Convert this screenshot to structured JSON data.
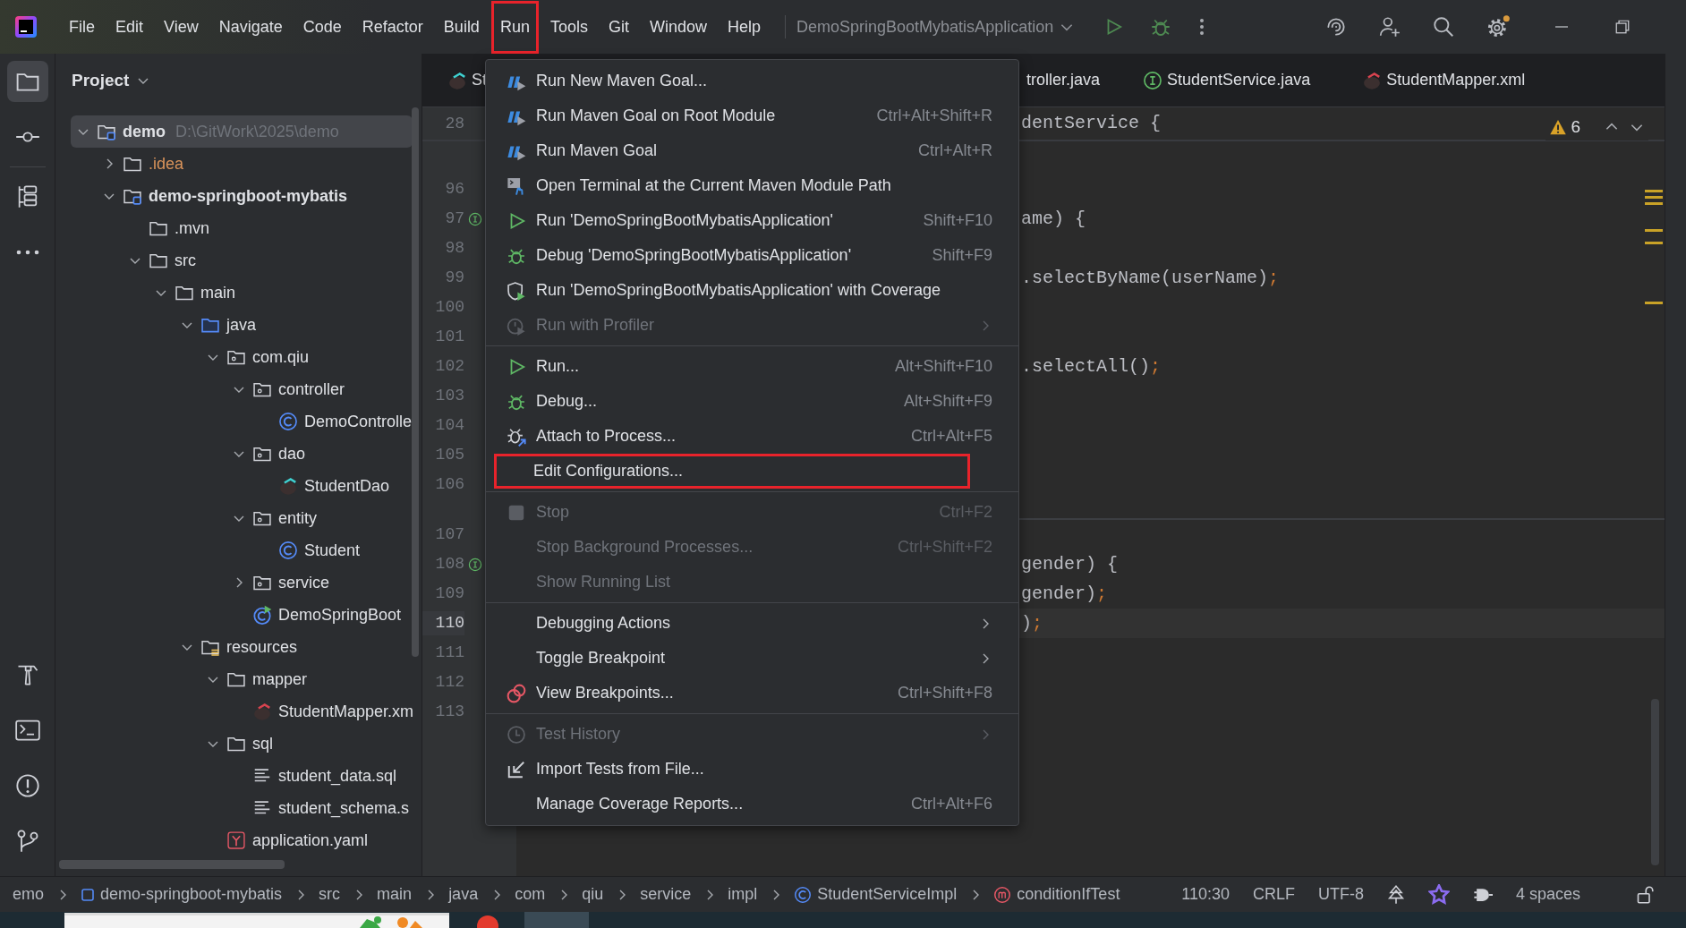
{
  "menu_bar": {
    "items": [
      {
        "label": "File",
        "highlighted": false
      },
      {
        "label": "Edit",
        "highlighted": false
      },
      {
        "label": "View",
        "highlighted": false
      },
      {
        "label": "Navigate",
        "highlighted": false
      },
      {
        "label": "Code",
        "highlighted": false
      },
      {
        "label": "Refactor",
        "highlighted": false
      },
      {
        "label": "Build",
        "highlighted": false
      },
      {
        "label": "Run",
        "highlighted": true
      },
      {
        "label": "Tools",
        "highlighted": false
      },
      {
        "label": "Git",
        "highlighted": false
      },
      {
        "label": "Window",
        "highlighted": false
      },
      {
        "label": "Help",
        "highlighted": false
      }
    ]
  },
  "run_config": {
    "label": "DemoSpringBootMybatisApplication"
  },
  "project": {
    "title": "Project",
    "tree": [
      {
        "label": "demo",
        "kind": "module",
        "path": "D:\\GitWork\\2025\\demo",
        "expanded": true,
        "selected": true,
        "children": [
          {
            "label": ".idea",
            "kind": "excluded-folder",
            "expanded": false,
            "selected": false
          },
          {
            "label": "demo-springboot-mybatis",
            "kind": "module",
            "expanded": true,
            "selected": false,
            "children": [
              {
                "label": ".mvn",
                "kind": "folder",
                "selected": false
              },
              {
                "label": "src",
                "kind": "folder",
                "expanded": true,
                "selected": false,
                "children": [
                  {
                    "label": "main",
                    "kind": "folder",
                    "expanded": true,
                    "selected": false,
                    "children": [
                      {
                        "label": "java",
                        "kind": "source-folder",
                        "expanded": true,
                        "selected": false,
                        "children": [
                          {
                            "label": "com.qiu",
                            "kind": "package",
                            "expanded": true,
                            "selected": false,
                            "children": [
                              {
                                "label": "controller",
                                "kind": "package",
                                "expanded": true,
                                "selected": false,
                                "children": [
                                  {
                                    "label": "DemoControlle",
                                    "kind": "class",
                                    "selected": false
                                  }
                                ]
                              },
                              {
                                "label": "dao",
                                "kind": "package",
                                "expanded": true,
                                "selected": false,
                                "children": [
                                  {
                                    "label": "StudentDao",
                                    "kind": "mapper",
                                    "selected": false
                                  }
                                ]
                              },
                              {
                                "label": "entity",
                                "kind": "package",
                                "expanded": true,
                                "selected": false,
                                "children": [
                                  {
                                    "label": "Student",
                                    "kind": "class",
                                    "selected": false
                                  }
                                ]
                              },
                              {
                                "label": "service",
                                "kind": "package",
                                "expanded": false,
                                "selected": false
                              },
                              {
                                "label": "DemoSpringBoot",
                                "kind": "app-class",
                                "selected": false
                              }
                            ]
                          }
                        ]
                      },
                      {
                        "label": "resources",
                        "kind": "resources-folder",
                        "expanded": true,
                        "selected": false,
                        "children": [
                          {
                            "label": "mapper",
                            "kind": "folder",
                            "expanded": true,
                            "selected": false,
                            "children": [
                              {
                                "label": "StudentMapper.xm",
                                "kind": "mapper-xml",
                                "selected": false
                              }
                            ]
                          },
                          {
                            "label": "sql",
                            "kind": "folder",
                            "expanded": true,
                            "selected": false,
                            "children": [
                              {
                                "label": "student_data.sql",
                                "kind": "text-file",
                                "selected": false
                              },
                              {
                                "label": "student_schema.s",
                                "kind": "text-file",
                                "selected": false
                              }
                            ]
                          },
                          {
                            "label": "application.yaml",
                            "kind": "yaml",
                            "selected": false
                          }
                        ]
                      }
                    ]
                  }
                ]
              }
            ]
          }
        ]
      }
    ]
  },
  "editor": {
    "tabs": [
      {
        "label": "St",
        "kind": "mapper"
      },
      {
        "label": "troller.java",
        "kind": "plain"
      },
      {
        "label": "StudentService.java",
        "kind": "interface"
      },
      {
        "label": "StudentMapper.xml",
        "kind": "mapper-xml"
      }
    ],
    "sticky": {
      "number": "28",
      "code": "dentService {"
    },
    "warnings": "6",
    "lines": [
      {
        "number": "96",
        "kind": "plain",
        "current": false
      },
      {
        "number": "97",
        "kind": "implements",
        "current": false,
        "code": "ame) {"
      },
      {
        "number": "98",
        "kind": "plain",
        "current": false
      },
      {
        "number": "99",
        "kind": "plain",
        "current": false,
        "code": ".selectByName(userName)",
        "punctuation": ";"
      },
      {
        "number": "100",
        "kind": "plain",
        "current": false
      },
      {
        "number": "101",
        "kind": "plain",
        "current": false
      },
      {
        "number": "102",
        "kind": "plain",
        "current": false,
        "code": ".selectAll()",
        "punctuation": ";"
      },
      {
        "number": "103",
        "kind": "plain",
        "current": false
      },
      {
        "number": "104",
        "kind": "plain",
        "current": false
      },
      {
        "number": "105",
        "kind": "plain",
        "current": false
      },
      {
        "number": "106",
        "kind": "plain",
        "current": false
      },
      {
        "number": "107",
        "kind": "plain",
        "current": false
      },
      {
        "number": "108",
        "kind": "implements",
        "current": false,
        "code": "gender) {"
      },
      {
        "number": "109",
        "kind": "plain",
        "current": false,
        "code": "gender)",
        "punctuation": ";"
      },
      {
        "number": "110",
        "kind": "plain",
        "current": true,
        "code": ")",
        "punctuation": ";"
      },
      {
        "number": "111",
        "kind": "plain",
        "current": false
      },
      {
        "number": "112",
        "kind": "plain",
        "current": false
      },
      {
        "number": "113",
        "kind": "plain",
        "current": false
      }
    ]
  },
  "run_menu": {
    "items": [
      {
        "kind": "item",
        "label": "Run New Maven Goal...",
        "disabled": false,
        "submenu": false,
        "highlighted": false
      },
      {
        "kind": "item",
        "label": "Run Maven Goal on Root Module",
        "shortcut": "Ctrl+Alt+Shift+R",
        "disabled": false,
        "submenu": false,
        "highlighted": false
      },
      {
        "kind": "item",
        "label": "Run Maven Goal",
        "shortcut": "Ctrl+Alt+R",
        "disabled": false,
        "submenu": false,
        "highlighted": false
      },
      {
        "kind": "item",
        "label": "Open Terminal at the Current Maven Module Path",
        "disabled": false,
        "submenu": false,
        "highlighted": false
      },
      {
        "kind": "item",
        "label": "Run 'DemoSpringBootMybatisApplication'",
        "shortcut": "Shift+F10",
        "disabled": false,
        "submenu": false,
        "highlighted": false
      },
      {
        "kind": "item",
        "label": "Debug 'DemoSpringBootMybatisApplication'",
        "shortcut": "Shift+F9",
        "disabled": false,
        "submenu": false,
        "highlighted": false
      },
      {
        "kind": "item",
        "label": "Run 'DemoSpringBootMybatisApplication' with Coverage",
        "disabled": false,
        "submenu": false,
        "highlighted": false
      },
      {
        "kind": "item",
        "label": "Run with Profiler",
        "disabled": true,
        "submenu": true,
        "highlighted": false
      },
      {
        "kind": "separator"
      },
      {
        "kind": "item",
        "label": "Run...",
        "shortcut": "Alt+Shift+F10",
        "disabled": false,
        "submenu": false,
        "highlighted": false
      },
      {
        "kind": "item",
        "label": "Debug...",
        "shortcut": "Alt+Shift+F9",
        "disabled": false,
        "submenu": false,
        "highlighted": false
      },
      {
        "kind": "item",
        "label": "Attach to Process...",
        "shortcut": "Ctrl+Alt+F5",
        "disabled": false,
        "submenu": false,
        "highlighted": false
      },
      {
        "kind": "item",
        "label": "Edit Configurations...",
        "disabled": false,
        "submenu": false,
        "highlighted": true
      },
      {
        "kind": "separator"
      },
      {
        "kind": "item",
        "label": "Stop",
        "shortcut": "Ctrl+F2",
        "disabled": true,
        "submenu": false,
        "highlighted": false
      },
      {
        "kind": "item",
        "label": "Stop Background Processes...",
        "shortcut": "Ctrl+Shift+F2",
        "disabled": true,
        "submenu": false,
        "highlighted": false
      },
      {
        "kind": "item",
        "label": "Show Running List",
        "disabled": true,
        "submenu": false,
        "highlighted": false
      },
      {
        "kind": "separator"
      },
      {
        "kind": "item",
        "label": "Debugging Actions",
        "disabled": false,
        "submenu": true,
        "highlighted": false
      },
      {
        "kind": "item",
        "label": "Toggle Breakpoint",
        "disabled": false,
        "submenu": true,
        "highlighted": false
      },
      {
        "kind": "item",
        "label": "View Breakpoints...",
        "shortcut": "Ctrl+Shift+F8",
        "disabled": false,
        "submenu": false,
        "highlighted": false
      },
      {
        "kind": "separator"
      },
      {
        "kind": "item",
        "label": "Test History",
        "disabled": true,
        "submenu": true,
        "highlighted": false
      },
      {
        "kind": "item",
        "label": "Import Tests from File...",
        "disabled": false,
        "submenu": false,
        "highlighted": false
      },
      {
        "kind": "item",
        "label": "Manage Coverage Reports...",
        "shortcut": "Ctrl+Alt+F6",
        "disabled": false,
        "submenu": false,
        "highlighted": false
      }
    ]
  },
  "status_bar": {
    "breadcrumbs": [
      {
        "label": "emo",
        "kind": "plain"
      },
      {
        "label": "demo-springboot-mybatis",
        "kind": "module"
      },
      {
        "label": "src",
        "kind": "plain"
      },
      {
        "label": "main",
        "kind": "plain"
      },
      {
        "label": "java",
        "kind": "plain"
      },
      {
        "label": "com",
        "kind": "plain"
      },
      {
        "label": "qiu",
        "kind": "plain"
      },
      {
        "label": "service",
        "kind": "plain"
      },
      {
        "label": "impl",
        "kind": "plain"
      },
      {
        "label": "StudentServiceImpl",
        "kind": "class"
      },
      {
        "label": "conditionIfTest",
        "kind": "method"
      }
    ],
    "position": "110:30",
    "line_separator": "CRLF",
    "encoding": "UTF-8",
    "indent": "4 spaces"
  }
}
